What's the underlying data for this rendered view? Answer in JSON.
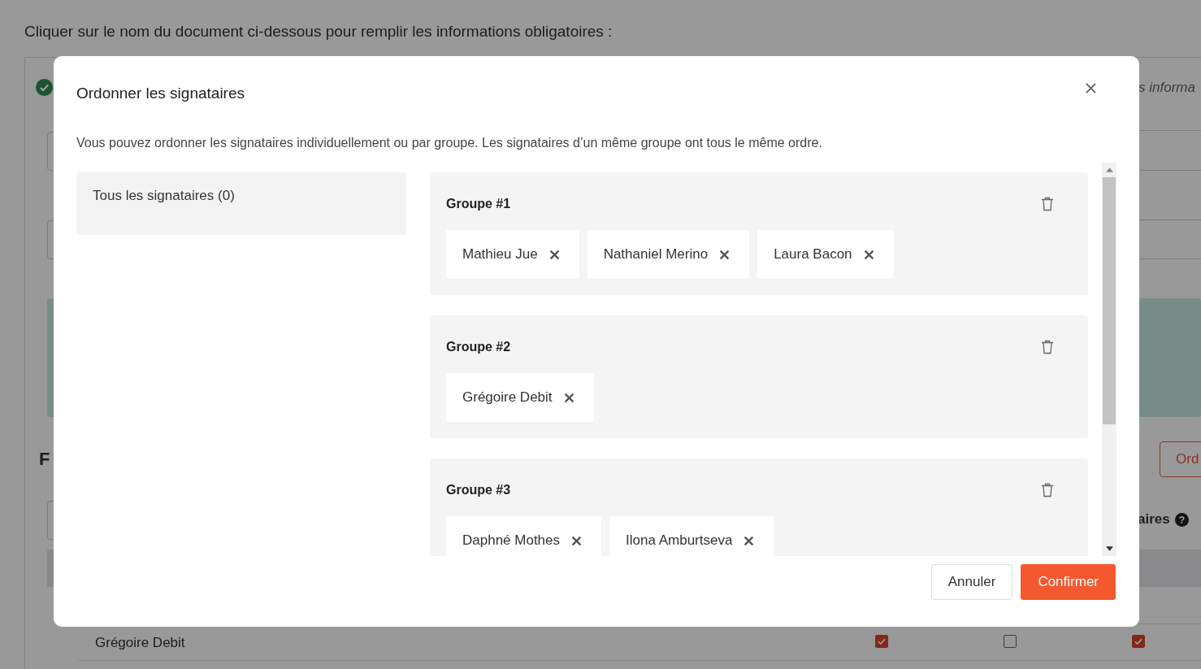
{
  "page": {
    "instruction": "Cliquer sur le nom du document ci-dessous pour remplir les informations obligatoires :",
    "document_hint": "s informa",
    "section_title": "F",
    "order_button": "Ord",
    "column_header": "aires",
    "help_mark": "?",
    "row": {
      "name": "Grégoire Debit",
      "checks": [
        true,
        false,
        true
      ]
    }
  },
  "dialog": {
    "title": "Ordonner les signataires",
    "description": "Vous pouvez ordonner les signataires individuellement ou par groupe. Les signataires d’un même groupe ont tous le même ordre.",
    "all_signers": "Tous les signataires (0)",
    "groups": [
      {
        "title": "Groupe #1",
        "signers": [
          "Mathieu Jue",
          "Nathaniel Merino",
          "Laura Bacon"
        ]
      },
      {
        "title": "Groupe #2",
        "signers": [
          "Grégoire Debit"
        ]
      },
      {
        "title": "Groupe #3",
        "signers": [
          "Daphné Mothes",
          "Ilona Amburtseva"
        ]
      }
    ],
    "buttons": {
      "cancel": "Annuler",
      "confirm": "Confirmer"
    }
  }
}
